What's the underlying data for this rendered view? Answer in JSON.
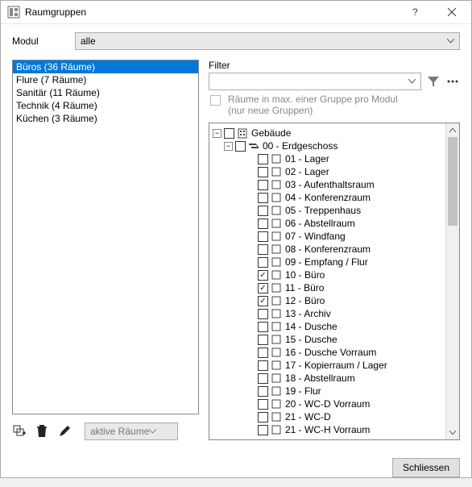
{
  "window": {
    "title": "Raumgruppen"
  },
  "modul": {
    "label": "Modul",
    "value": "alle"
  },
  "groups": [
    {
      "label": "Büros (36 Räume)",
      "selected": true
    },
    {
      "label": "Flure (7 Räume)",
      "selected": false
    },
    {
      "label": "Sanitär (11 Räume)",
      "selected": false
    },
    {
      "label": "Technik (4 Räume)",
      "selected": false
    },
    {
      "label": "Küchen (3 Räume)",
      "selected": false
    }
  ],
  "left_toolbar": {
    "dropdown": "aktive Räume"
  },
  "filter": {
    "label": "Filter",
    "placeholder": "",
    "constraint_line1": "Räume in max. einer Gruppe pro Modul",
    "constraint_line2": "(nur neue Gruppen)"
  },
  "tree": {
    "root": {
      "label": "Gebäude",
      "expanded": true,
      "checked": false,
      "children": [
        {
          "label": "00 - Erdgeschoss",
          "expanded": true,
          "checked": false,
          "children": [
            {
              "label": "01 - Lager",
              "checked": false
            },
            {
              "label": "02 - Lager",
              "checked": false
            },
            {
              "label": "03 - Aufenthaltsraum",
              "checked": false
            },
            {
              "label": "04 - Konferenzraum",
              "checked": false
            },
            {
              "label": "05 - Treppenhaus",
              "checked": false
            },
            {
              "label": "06 - Abstellraum",
              "checked": false
            },
            {
              "label": "07 - Windfang",
              "checked": false
            },
            {
              "label": "08 - Konferenzraum",
              "checked": false
            },
            {
              "label": "09 - Empfang / Flur",
              "checked": false
            },
            {
              "label": "10 - Büro",
              "checked": true
            },
            {
              "label": "11 - Büro",
              "checked": true
            },
            {
              "label": "12 - Büro",
              "checked": true
            },
            {
              "label": "13 - Archiv",
              "checked": false
            },
            {
              "label": "14 - Dusche",
              "checked": false
            },
            {
              "label": "15 - Dusche",
              "checked": false
            },
            {
              "label": "16 - Dusche Vorraum",
              "checked": false
            },
            {
              "label": "17 - Kopierraum / Lager",
              "checked": false
            },
            {
              "label": "18 - Abstellraum",
              "checked": false
            },
            {
              "label": "19 - Flur",
              "checked": false
            },
            {
              "label": "20 - WC-D Vorraum",
              "checked": false
            },
            {
              "label": "21 - WC-D",
              "checked": false
            },
            {
              "label": "21 - WC-H Vorraum",
              "checked": false
            }
          ]
        }
      ]
    }
  },
  "footer": {
    "close": "Schliessen"
  }
}
